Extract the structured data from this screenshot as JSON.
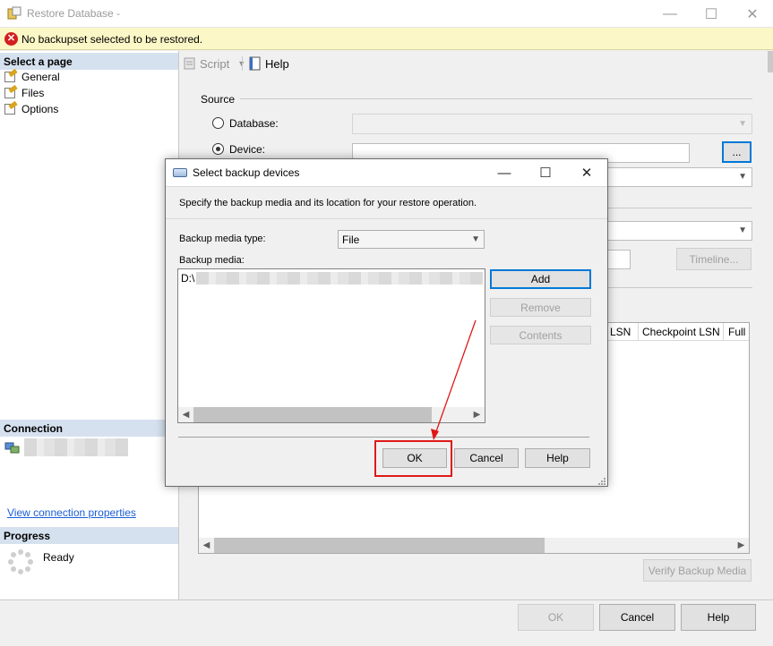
{
  "window": {
    "title": "Restore Database -",
    "minimize": "—",
    "maximize": "☐",
    "close": "✕"
  },
  "error_bar": {
    "message": "No backupset selected to be restored."
  },
  "left_pane": {
    "select_page_header": "Select a page",
    "pages": [
      "General",
      "Files",
      "Options"
    ],
    "connection_header": "Connection",
    "view_connection_link": "View connection properties",
    "progress_header": "Progress",
    "progress_status": "Ready"
  },
  "toolbar": {
    "script_label": "Script",
    "help_label": "Help"
  },
  "source": {
    "group_label": "Source",
    "database_label": "Database:",
    "device_label": "Device:",
    "browse_label": "...",
    "selected_option": "Device"
  },
  "main": {
    "timeline_label": "Timeline...",
    "grid_columns": [
      "LSN",
      "Checkpoint LSN",
      "Full LS"
    ],
    "verify_label": "Verify Backup Media"
  },
  "footer": {
    "ok_label": "OK",
    "cancel_label": "Cancel",
    "help_label": "Help"
  },
  "dialog": {
    "title": "Select backup devices",
    "minimize": "—",
    "maximize": "☐",
    "close": "✕",
    "instruction": "Specify the backup media and its location for your restore operation.",
    "media_type_label": "Backup media type:",
    "media_type_value": "File",
    "media_label": "Backup media:",
    "media_items": [
      "D:\\"
    ],
    "add_label": "Add",
    "remove_label": "Remove",
    "contents_label": "Contents",
    "ok_label": "OK",
    "cancel_label": "Cancel",
    "help_label": "Help"
  },
  "colors": {
    "accent": "#0078d7",
    "annotation_red": "#e01818",
    "error_bar": "#fbf7c6",
    "section_header": "#d6e1ef"
  },
  "icons": [
    "app-icon",
    "error-icon",
    "page-icon",
    "connection-icon",
    "spinner-icon",
    "script-icon",
    "help-icon",
    "dialog-icon"
  ]
}
